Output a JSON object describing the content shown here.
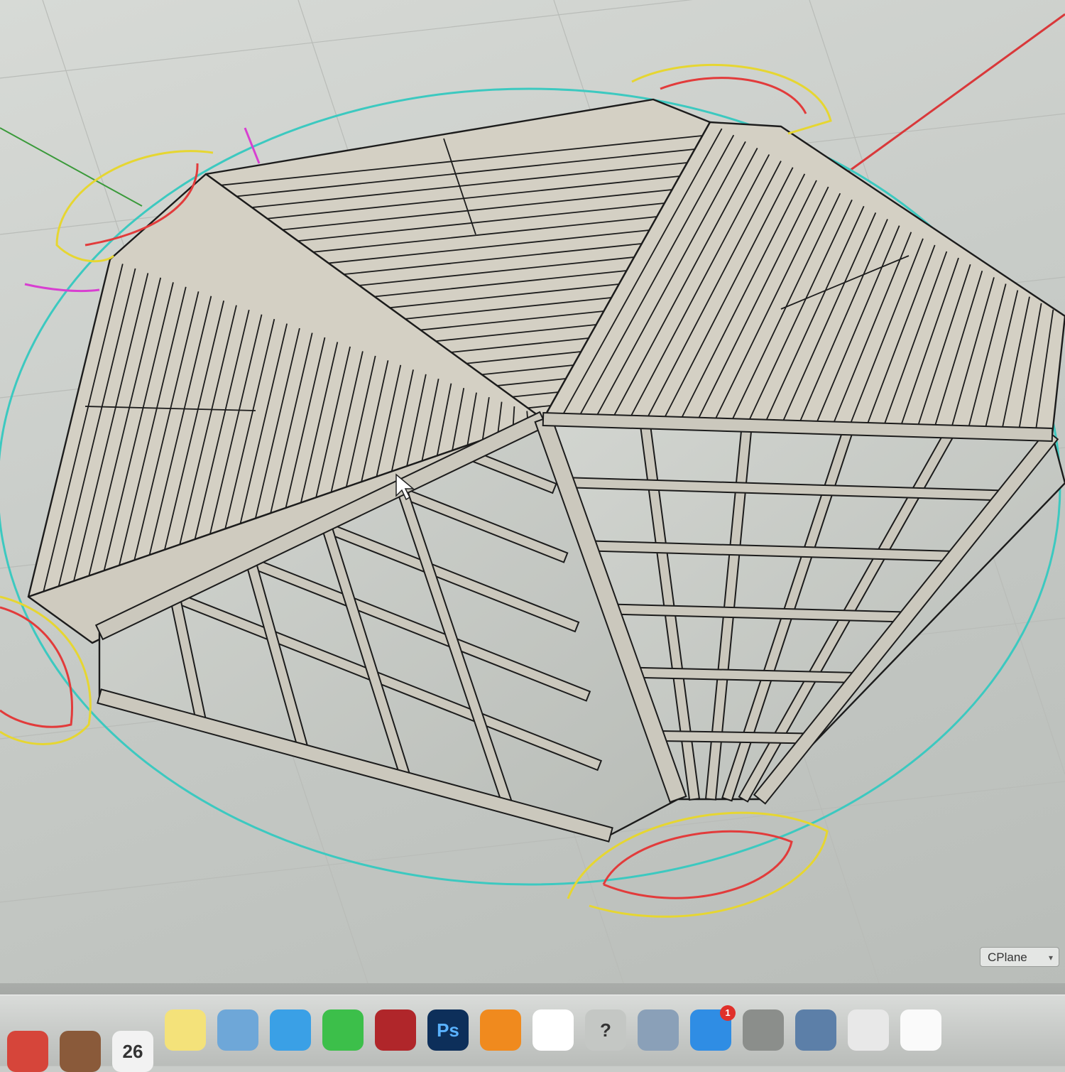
{
  "app": {
    "name": "Rhino 3D modeling viewport",
    "colors": {
      "viewport_bg": "#cfd2ce",
      "panel_fill": "#d4d0c4",
      "frame_fill": "#c9c6bb",
      "outline": "#1c1c1c",
      "grid": "#b9bcb8",
      "x_axis": "#d9383a",
      "y_axis": "#3a9a3a",
      "gumball_ring": "#3cc9c0",
      "gumball_yellow": "#e6d631",
      "gumball_red": "#e23b3b",
      "gumball_magenta": "#d83fd1"
    }
  },
  "viewport": {
    "cplane_label": "CPlane",
    "object_description": "octagonal hip roof with slatted panels and open timber frame"
  },
  "dock": {
    "items": [
      {
        "name": "chrome-icon",
        "color": "#d6453a"
      },
      {
        "name": "notes-app-icon",
        "color": "#8a5a3a"
      },
      {
        "name": "calendar-icon",
        "color": "#f2f2f2",
        "label": "26"
      },
      {
        "name": "notepad-icon",
        "color": "#f4e27a"
      },
      {
        "name": "preview-icon",
        "color": "#6ea7d8"
      },
      {
        "name": "messages-icon",
        "color": "#3aa0e6"
      },
      {
        "name": "facetime-icon",
        "color": "#3cbf4a"
      },
      {
        "name": "photo-booth-icon",
        "color": "#b0262a"
      },
      {
        "name": "photoshop-icon",
        "color": "#0d2f5a",
        "label": "Ps"
      },
      {
        "name": "ibooks-icon",
        "color": "#f08a1e"
      },
      {
        "name": "finder-star-icon",
        "color": "#ffffff"
      },
      {
        "name": "help-icon",
        "color": "#c4c7c4",
        "label": "?"
      },
      {
        "name": "no-entry-icon",
        "color": "#8aa0b8"
      },
      {
        "name": "app-store-icon",
        "color": "#2f8de4",
        "badge": "1"
      },
      {
        "name": "system-preferences-icon",
        "color": "#8b8e8b"
      },
      {
        "name": "image-preview-icon",
        "color": "#5c7fa8"
      },
      {
        "name": "rhino-icon",
        "color": "#e8e8e8"
      },
      {
        "name": "document-icon",
        "color": "#fafafa"
      }
    ]
  }
}
